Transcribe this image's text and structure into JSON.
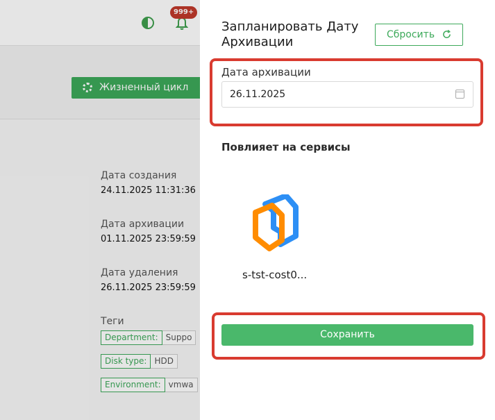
{
  "background": {
    "notifications_badge": "999+",
    "lifecycle_button": "Жизненный цикл",
    "info": [
      {
        "label": "Дата создания",
        "value": "24.11.2025 11:31:36"
      },
      {
        "label": "Дата архивации",
        "value": "01.11.2025 23:59:59"
      },
      {
        "label": "Дата удаления",
        "value": "26.11.2025 23:59:59"
      }
    ],
    "tags_label": "Теги",
    "tags": [
      {
        "key": "Department:",
        "value": "Suppo"
      },
      {
        "key": "Disk type:",
        "value": "HDD"
      },
      {
        "key": "Environment:",
        "value": "vmwa"
      }
    ]
  },
  "drawer": {
    "title": "Запланировать Дату Архивации",
    "reset_label": "Сбросить",
    "date_field": {
      "label": "Дата архивации",
      "value": "26.11.2025"
    },
    "affects_label": "Повлияет на сервисы",
    "service": {
      "name": "s-tst-cost0..."
    },
    "save_label": "Сохранить"
  },
  "colors": {
    "accent": "#3da95a",
    "highlight": "#d93b30",
    "badge": "#c0392b"
  }
}
